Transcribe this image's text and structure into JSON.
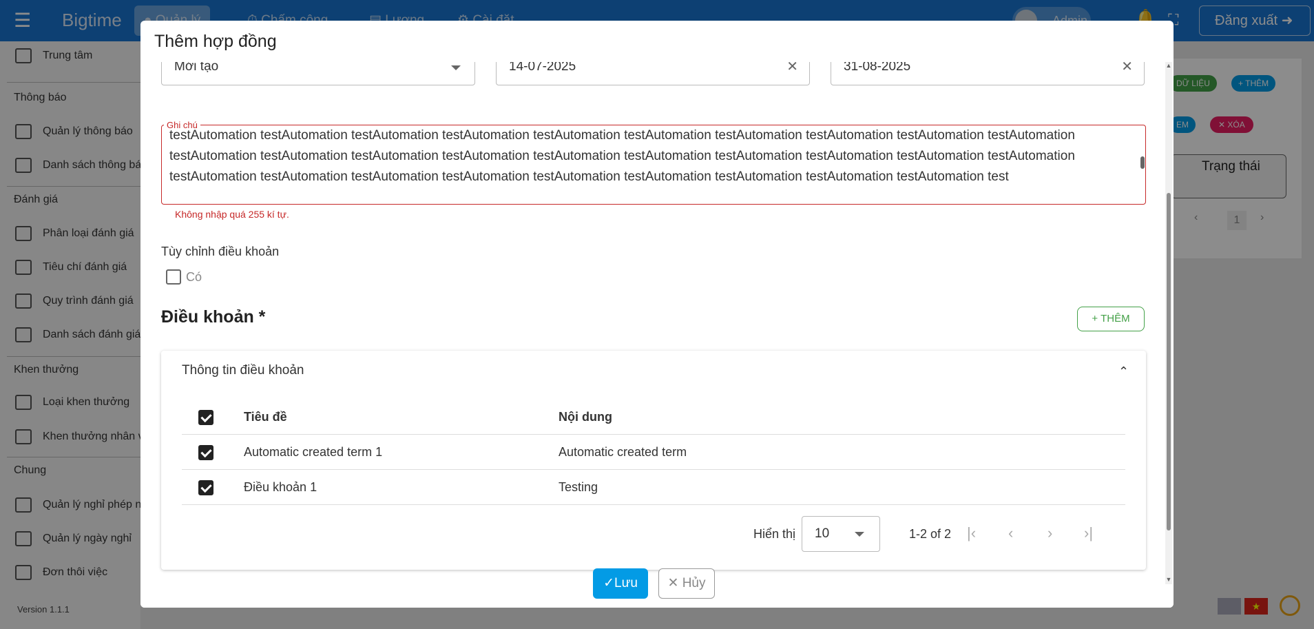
{
  "appbar": {
    "brand": "Bigtime",
    "tabs": [
      "Quản lý",
      "Chấm công",
      "Lương",
      "Cài đặt"
    ],
    "user": "Admin",
    "logout_label": "Đăng xuất"
  },
  "sidebar": {
    "items": [
      {
        "label": "Trung tâm"
      },
      {
        "label": "Quản lý thông báo"
      },
      {
        "label": "Danh sách thông báo"
      },
      {
        "label": "Phân loại đánh giá"
      },
      {
        "label": "Tiêu chí đánh giá"
      },
      {
        "label": "Quy trình đánh giá"
      },
      {
        "label": "Danh sách đánh giá"
      },
      {
        "label": "Loại khen thưởng"
      },
      {
        "label": "Khen thưởng nhân viên"
      },
      {
        "label": "Quản lý nghỉ phép nhân viên"
      },
      {
        "label": "Quản lý ngày nghỉ"
      },
      {
        "label": "Đơn thôi việc"
      }
    ],
    "headings": [
      "Thông báo",
      "Đánh giá",
      "Khen thưởng",
      "Chung"
    ],
    "version": "Version 1.1.1"
  },
  "background": {
    "data_button": "DỮ LIỆU",
    "add_button": "+ THÊM",
    "search_button": "EM",
    "delete_button": "XÓA",
    "status_header": "Trạng thái",
    "page": "1"
  },
  "modal": {
    "title": "Thêm hợp đồng",
    "status_value": "Mới tạo",
    "start_date": "14-07-2025",
    "end_date": "31-08-2025",
    "note_label": "Ghi chú",
    "note_text": "testAutomation testAutomation testAutomation testAutomation testAutomation testAutomation testAutomation testAutomation testAutomation testAutomation testAutomation testAutomation testAutomation testAutomation testAutomation testAutomation testAutomation testAutomation testAutomation testAutomation testAutomation testAutomation testAutomation testAutomation testAutomation testAutomation testAutomation testAutomation testAutomation test",
    "note_error": "Không nhập quá 255 kí tự.",
    "custom_terms_label": "Tùy chỉnh điều khoản",
    "custom_terms_option": "Có",
    "terms_title": "Điều khoản *",
    "terms_add": "+ THÊM",
    "card_title": "Thông tin điều khoản",
    "table": {
      "headers": [
        "Tiêu đề",
        "Nội dung"
      ],
      "rows": [
        {
          "title": "Automatic created term 1",
          "content": "Automatic created term"
        },
        {
          "title": "Điều khoản 1",
          "content": "Testing"
        }
      ]
    },
    "pager": {
      "label": "Hiển thị",
      "page_size": "10",
      "range": "1-2 of 2"
    },
    "save_label": "Lưu",
    "cancel_label": "Hủy"
  }
}
